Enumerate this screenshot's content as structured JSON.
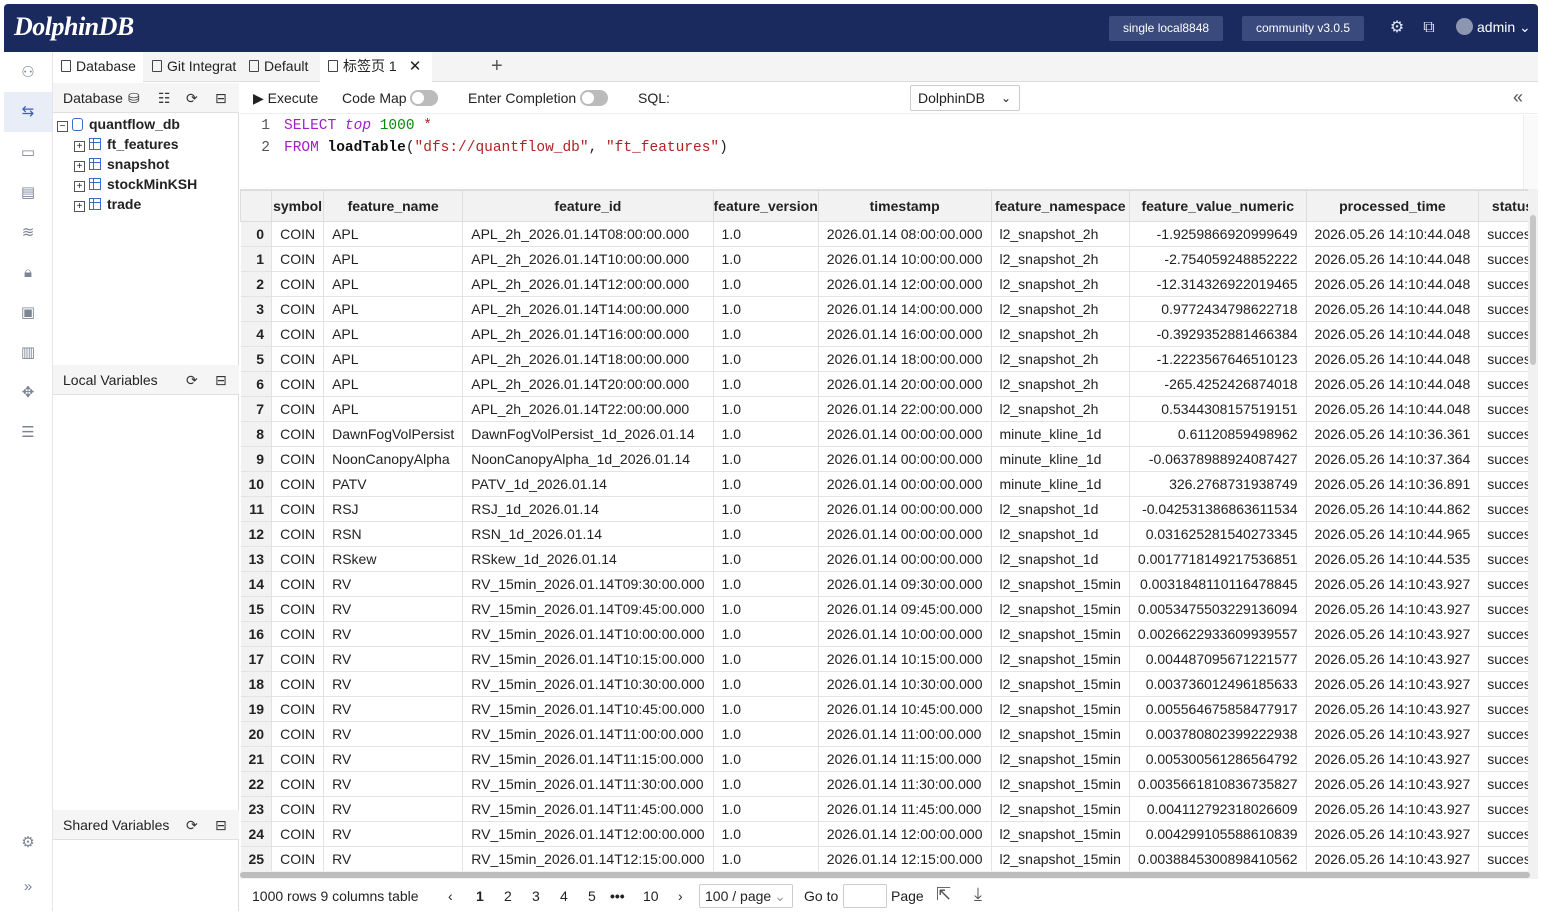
{
  "app": {
    "logo_text": "DolphinDB"
  },
  "header": {
    "server_pill": "single local8848",
    "version_pill": "community v3.0.5",
    "user": "admin"
  },
  "tabs": [
    {
      "label": "Database",
      "icon": "database-tab-icon"
    },
    {
      "label": "Git Integrat",
      "icon": "git-folder-icon"
    },
    {
      "label": "Default",
      "icon": "file-icon"
    },
    {
      "label": "标签页 1",
      "icon": "file-icon"
    }
  ],
  "database_panel": {
    "title": "Database",
    "db_name": "quantflow_db",
    "tables": [
      "ft_features",
      "snapshot",
      "stockMinKSH",
      "trade"
    ]
  },
  "local_vars": {
    "title": "Local Variables"
  },
  "shared_vars": {
    "title": "Shared Variables"
  },
  "toolbar": {
    "execute": "Execute",
    "code_map": "Code Map",
    "enter_completion": "Enter Completion",
    "sql_label": "SQL:",
    "sql_dialect": "DolphinDB"
  },
  "editor": {
    "line_numbers": [
      "1",
      "2"
    ],
    "line1": {
      "kw1": "SELECT",
      "kw2": "top",
      "num": "1000",
      "star": "*"
    },
    "line2": {
      "kw": "FROM",
      "fn": "loadTable",
      "arg1": "\"dfs://quantflow_db\"",
      "arg2": "\"ft_features\""
    }
  },
  "grid": {
    "columns": [
      "symbol",
      "feature_name",
      "feature_id",
      "feature_version",
      "timestamp",
      "feature_namespace",
      "feature_value_numeric",
      "processed_time",
      "status"
    ],
    "rows": [
      [
        "0",
        "COIN",
        "APL",
        "APL_2h_2026.01.14T08:00:00.000",
        "1.0",
        "2026.01.14 08:00:00.000",
        "l2_snapshot_2h",
        "-1.9259866920999649",
        "2026.05.26 14:10:44.048",
        "success"
      ],
      [
        "1",
        "COIN",
        "APL",
        "APL_2h_2026.01.14T10:00:00.000",
        "1.0",
        "2026.01.14 10:00:00.000",
        "l2_snapshot_2h",
        "-2.754059248852222",
        "2026.05.26 14:10:44.048",
        "success"
      ],
      [
        "2",
        "COIN",
        "APL",
        "APL_2h_2026.01.14T12:00:00.000",
        "1.0",
        "2026.01.14 12:00:00.000",
        "l2_snapshot_2h",
        "-12.314326922019465",
        "2026.05.26 14:10:44.048",
        "success"
      ],
      [
        "3",
        "COIN",
        "APL",
        "APL_2h_2026.01.14T14:00:00.000",
        "1.0",
        "2026.01.14 14:00:00.000",
        "l2_snapshot_2h",
        "0.9772434798622718",
        "2026.05.26 14:10:44.048",
        "success"
      ],
      [
        "4",
        "COIN",
        "APL",
        "APL_2h_2026.01.14T16:00:00.000",
        "1.0",
        "2026.01.14 16:00:00.000",
        "l2_snapshot_2h",
        "-0.3929352881466384",
        "2026.05.26 14:10:44.048",
        "success"
      ],
      [
        "5",
        "COIN",
        "APL",
        "APL_2h_2026.01.14T18:00:00.000",
        "1.0",
        "2026.01.14 18:00:00.000",
        "l2_snapshot_2h",
        "-1.2223567646510123",
        "2026.05.26 14:10:44.048",
        "success"
      ],
      [
        "6",
        "COIN",
        "APL",
        "APL_2h_2026.01.14T20:00:00.000",
        "1.0",
        "2026.01.14 20:00:00.000",
        "l2_snapshot_2h",
        "-265.4252426874018",
        "2026.05.26 14:10:44.048",
        "success"
      ],
      [
        "7",
        "COIN",
        "APL",
        "APL_2h_2026.01.14T22:00:00.000",
        "1.0",
        "2026.01.14 22:00:00.000",
        "l2_snapshot_2h",
        "0.5344308157519151",
        "2026.05.26 14:10:44.048",
        "success"
      ],
      [
        "8",
        "COIN",
        "DawnFogVolPersist",
        "DawnFogVolPersist_1d_2026.01.14",
        "1.0",
        "2026.01.14 00:00:00.000",
        "minute_kline_1d",
        "0.61120859498962",
        "2026.05.26 14:10:36.361",
        "success"
      ],
      [
        "9",
        "COIN",
        "NoonCanopyAlpha",
        "NoonCanopyAlpha_1d_2026.01.14",
        "1.0",
        "2026.01.14 00:00:00.000",
        "minute_kline_1d",
        "-0.06378988924087427",
        "2026.05.26 14:10:37.364",
        "success"
      ],
      [
        "10",
        "COIN",
        "PATV",
        "PATV_1d_2026.01.14",
        "1.0",
        "2026.01.14 00:00:00.000",
        "minute_kline_1d",
        "326.2768731938749",
        "2026.05.26 14:10:36.891",
        "success"
      ],
      [
        "11",
        "COIN",
        "RSJ",
        "RSJ_1d_2026.01.14",
        "1.0",
        "2026.01.14 00:00:00.000",
        "l2_snapshot_1d",
        "-0.042531386863611534",
        "2026.05.26 14:10:44.862",
        "success"
      ],
      [
        "12",
        "COIN",
        "RSN",
        "RSN_1d_2026.01.14",
        "1.0",
        "2026.01.14 00:00:00.000",
        "l2_snapshot_1d",
        "0.031625281540273345",
        "2026.05.26 14:10:44.965",
        "success"
      ],
      [
        "13",
        "COIN",
        "RSkew",
        "RSkew_1d_2026.01.14",
        "1.0",
        "2026.01.14 00:00:00.000",
        "l2_snapshot_1d",
        "0.0017718149217536851",
        "2026.05.26 14:10:44.535",
        "success"
      ],
      [
        "14",
        "COIN",
        "RV",
        "RV_15min_2026.01.14T09:30:00.000",
        "1.0",
        "2026.01.14 09:30:00.000",
        "l2_snapshot_15min",
        "0.0031848110116478845",
        "2026.05.26 14:10:43.927",
        "success"
      ],
      [
        "15",
        "COIN",
        "RV",
        "RV_15min_2026.01.14T09:45:00.000",
        "1.0",
        "2026.01.14 09:45:00.000",
        "l2_snapshot_15min",
        "0.0053475503229136094",
        "2026.05.26 14:10:43.927",
        "success"
      ],
      [
        "16",
        "COIN",
        "RV",
        "RV_15min_2026.01.14T10:00:00.000",
        "1.0",
        "2026.01.14 10:00:00.000",
        "l2_snapshot_15min",
        "0.0026622933609939557",
        "2026.05.26 14:10:43.927",
        "success"
      ],
      [
        "17",
        "COIN",
        "RV",
        "RV_15min_2026.01.14T10:15:00.000",
        "1.0",
        "2026.01.14 10:15:00.000",
        "l2_snapshot_15min",
        "0.004487095671221577",
        "2026.05.26 14:10:43.927",
        "success"
      ],
      [
        "18",
        "COIN",
        "RV",
        "RV_15min_2026.01.14T10:30:00.000",
        "1.0",
        "2026.01.14 10:30:00.000",
        "l2_snapshot_15min",
        "0.003736012496185633",
        "2026.05.26 14:10:43.927",
        "success"
      ],
      [
        "19",
        "COIN",
        "RV",
        "RV_15min_2026.01.14T10:45:00.000",
        "1.0",
        "2026.01.14 10:45:00.000",
        "l2_snapshot_15min",
        "0.005564675858477917",
        "2026.05.26 14:10:43.927",
        "success"
      ],
      [
        "20",
        "COIN",
        "RV",
        "RV_15min_2026.01.14T11:00:00.000",
        "1.0",
        "2026.01.14 11:00:00.000",
        "l2_snapshot_15min",
        "0.003780802399222938",
        "2026.05.26 14:10:43.927",
        "success"
      ],
      [
        "21",
        "COIN",
        "RV",
        "RV_15min_2026.01.14T11:15:00.000",
        "1.0",
        "2026.01.14 11:15:00.000",
        "l2_snapshot_15min",
        "0.005300561286564792",
        "2026.05.26 14:10:43.927",
        "success"
      ],
      [
        "22",
        "COIN",
        "RV",
        "RV_15min_2026.01.14T11:30:00.000",
        "1.0",
        "2026.01.14 11:30:00.000",
        "l2_snapshot_15min",
        "0.0035661810836735827",
        "2026.05.26 14:10:43.927",
        "success"
      ],
      [
        "23",
        "COIN",
        "RV",
        "RV_15min_2026.01.14T11:45:00.000",
        "1.0",
        "2026.01.14 11:45:00.000",
        "l2_snapshot_15min",
        "0.004112792318026609",
        "2026.05.26 14:10:43.927",
        "success"
      ],
      [
        "24",
        "COIN",
        "RV",
        "RV_15min_2026.01.14T12:00:00.000",
        "1.0",
        "2026.01.14 12:00:00.000",
        "l2_snapshot_15min",
        "0.004299105588610839",
        "2026.05.26 14:10:43.927",
        "success"
      ],
      [
        "25",
        "COIN",
        "RV",
        "RV_15min_2026.01.14T12:15:00.000",
        "1.0",
        "2026.01.14 12:15:00.000",
        "l2_snapshot_15min",
        "0.0038845300898410562",
        "2026.05.26 14:10:43.927",
        "success"
      ]
    ]
  },
  "pagination": {
    "summary": "1000 rows 9 columns table",
    "pages": [
      "1",
      "2",
      "3",
      "4",
      "5",
      "•••",
      "10"
    ],
    "current_page": "1",
    "page_size": "100 / page",
    "goto_label": "Go to",
    "page_label": "Page"
  },
  "colors": {
    "header_bg": "#1b2a5e",
    "pill_bg": "#3a4a7c",
    "accent": "#3a6ad0"
  }
}
